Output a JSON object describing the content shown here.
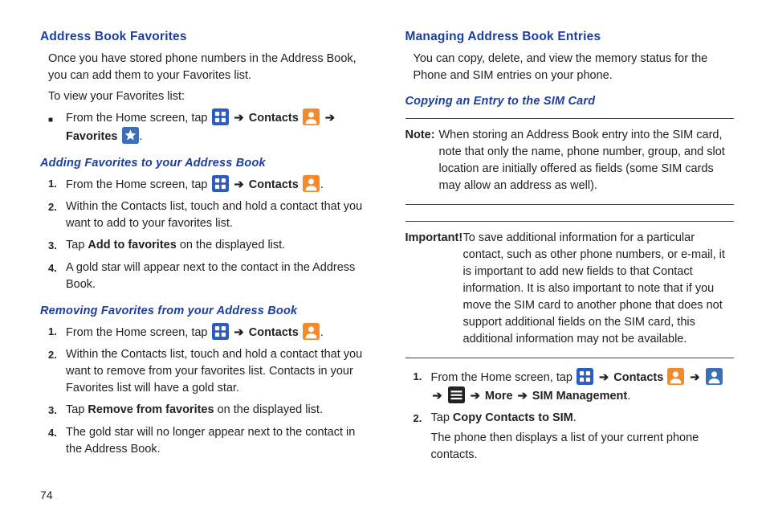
{
  "left": {
    "h1": "Address Book Favorites",
    "p1": "Once you have stored phone numbers in the Address Book, you can add them to your Favorites list.",
    "p2": "To view your Favorites list:",
    "bullet1_a": "From the Home screen, tap ",
    "bullet1_contacts": "Contacts",
    "bullet1_favorites": "Favorites",
    "sub1": "Adding Favorites to your Address Book",
    "add": {
      "n1_a": "From the Home screen, tap ",
      "n1_contacts": "Contacts",
      "n2": "Within the Contacts list, touch and hold a contact that you want to add to your favorites list.",
      "n3_a": "Tap ",
      "n3_b": "Add to favorites",
      "n3_c": " on the displayed list.",
      "n4": "A gold star will appear next to the contact in the Address Book."
    },
    "sub2": "Removing Favorites from your Address Book",
    "rem": {
      "n1_a": "From the Home screen, tap ",
      "n1_contacts": "Contacts",
      "n2": "Within the Contacts list, touch and hold a contact that you want to remove from your favorites list. Contacts in your Favorites list will have a gold star.",
      "n3_a": "Tap ",
      "n3_b": "Remove from favorites",
      "n3_c": " on the displayed list.",
      "n4": "The gold star will no longer appear next to the contact in the Address Book."
    },
    "pagenum": "74"
  },
  "right": {
    "h1": "Managing Address Book Entries",
    "p1": "You can copy, delete, and view the memory status for the Phone and SIM entries on your phone.",
    "sub1": "Copying an Entry to the SIM Card",
    "note_label": "Note:",
    "note_body": "When storing an Address Book entry into the SIM card, note that only the name, phone number, group, and slot location are initially offered as fields (some SIM cards may allow an address as well).",
    "imp_label": "Important!",
    "imp_body": "To save additional information for a particular contact, such as other phone numbers, or e-mail, it is important to add new fields to that Contact information. It is also important to note that if you move the SIM card to another phone that does not support additional fields on the SIM card, this additional information may not be available.",
    "steps": {
      "n1_a": "From the Home screen, tap ",
      "n1_contacts": "Contacts",
      "n1_more": "More",
      "n1_sim": "SIM Management",
      "n2_a": "Tap ",
      "n2_b": "Copy Contacts to SIM",
      "n2_c": ".",
      "n2_body": "The phone then displays a list of your current phone contacts."
    }
  },
  "arrow": "➔"
}
